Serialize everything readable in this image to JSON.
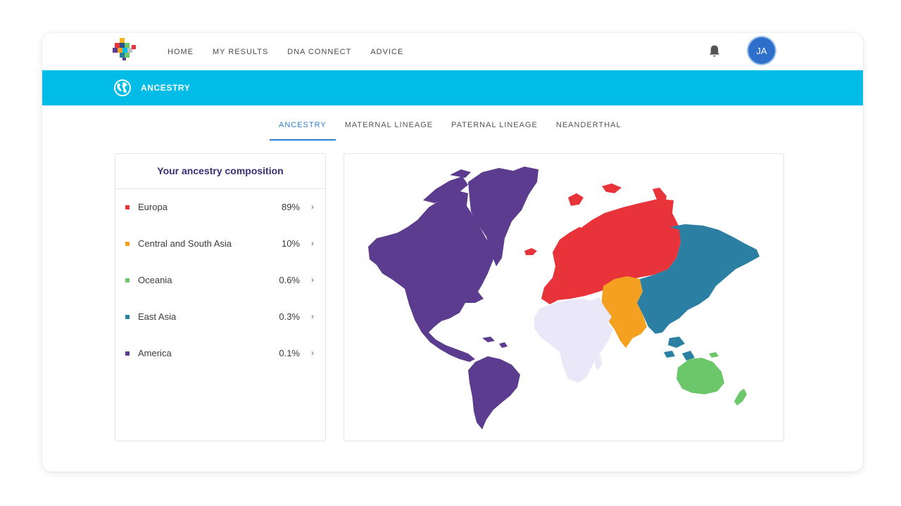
{
  "nav": {
    "links": [
      "HOME",
      "MY RESULTS",
      "DNA CONNECT",
      "ADVICE"
    ],
    "avatar_initials": "JA",
    "bell_icon": "bell-icon",
    "logo_icon": "pixel-cross-logo-icon"
  },
  "section": {
    "title": "ANCESTRY",
    "icon": "globe-icon",
    "color": "#00bce6"
  },
  "tabs": [
    {
      "label": "ANCESTRY",
      "active": true
    },
    {
      "label": "MATERNAL LINEAGE",
      "active": false
    },
    {
      "label": "PATERNAL LINEAGE",
      "active": false
    },
    {
      "label": "NEANDERTHAL",
      "active": false
    }
  ],
  "composition": {
    "title": "Your ancestry composition",
    "regions": [
      {
        "name": "Europa",
        "percent": "89%",
        "color": "#e8333a"
      },
      {
        "name": "Central and South Asia",
        "percent": "10%",
        "color": "#f4a020"
      },
      {
        "name": "Oceania",
        "percent": "0.6%",
        "color": "#6cc76a"
      },
      {
        "name": "East Asia",
        "percent": "0.3%",
        "color": "#2a7fa3"
      },
      {
        "name": "America",
        "percent": "0.1%",
        "color": "#5b3c8e"
      }
    ]
  },
  "map": {
    "unassigned_color": "#e9e7f8"
  }
}
